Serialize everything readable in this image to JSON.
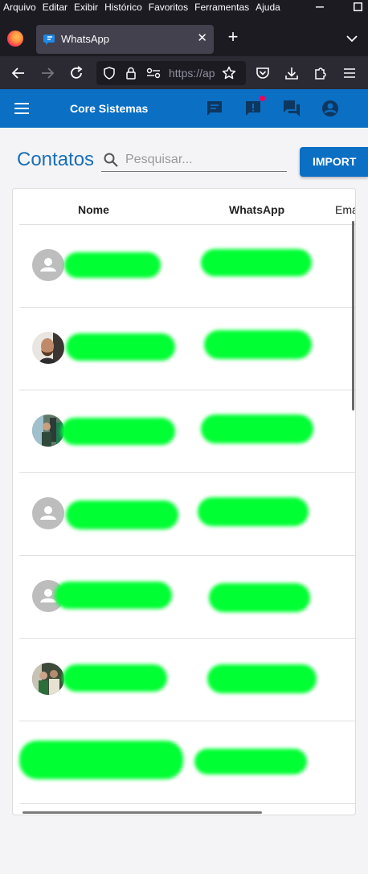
{
  "browser": {
    "menu": [
      "Arquivo",
      "Editar",
      "Exibir",
      "Histórico",
      "Favoritos",
      "Ferramentas",
      "Ajuda"
    ],
    "tab_title": "WhatsApp",
    "url": "https://ap",
    "icons": [
      "firefox-logo",
      "whatsapp-favicon",
      "close-icon",
      "plus-icon",
      "chevron-down-icon",
      "back-arrow-icon",
      "forward-arrow-icon",
      "reload-icon",
      "shield-icon",
      "lock-icon",
      "permissions-icon",
      "star-icon",
      "pocket-icon",
      "download-icon",
      "extensions-icon",
      "hamburger-menu-icon"
    ]
  },
  "appbar": {
    "title": "Core Sistemas",
    "color": "#0b6fc4",
    "icons": [
      "menu-icon",
      "chat-icon",
      "feedback-icon",
      "forum-icon",
      "account-icon"
    ]
  },
  "page": {
    "title": "Contatos",
    "search_placeholder": "Pesquisar...",
    "import_button": "IMPORT"
  },
  "table": {
    "columns": [
      "Nome",
      "WhatsApp",
      "Ema"
    ],
    "rows": [
      {
        "avatar": "default"
      },
      {
        "avatar": "photo"
      },
      {
        "avatar": "photo"
      },
      {
        "avatar": "default"
      },
      {
        "avatar": "default"
      },
      {
        "avatar": "photo"
      },
      {
        "avatar": "none"
      }
    ]
  }
}
